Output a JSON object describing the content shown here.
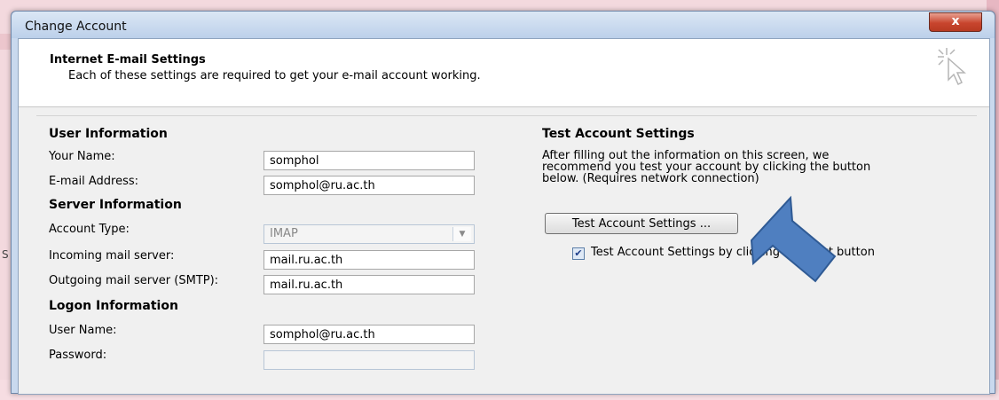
{
  "window": {
    "title": "Change Account",
    "close_label": "x"
  },
  "header": {
    "title": "Internet E-mail Settings",
    "subtitle": "Each of these settings are required to get your e-mail account working."
  },
  "user_info": {
    "section": "User Information",
    "name_label": "Your Name:",
    "name_value": "somphol",
    "email_label": "E-mail Address:",
    "email_value": "somphol@ru.ac.th"
  },
  "server_info": {
    "section": "Server Information",
    "type_label": "Account Type:",
    "type_value": "IMAP",
    "incoming_label": "Incoming mail server:",
    "incoming_value": "mail.ru.ac.th",
    "outgoing_label": "Outgoing mail server (SMTP):",
    "outgoing_value": "mail.ru.ac.th"
  },
  "logon_info": {
    "section": "Logon Information",
    "user_label": "User Name:",
    "user_value": "somphol@ru.ac.th",
    "password_label": "Password:",
    "password_value": ""
  },
  "test": {
    "section": "Test Account Settings",
    "desc_line1": "After filling out the information on this screen, we",
    "desc_line2": "recommend you test your account by clicking the button",
    "desc_line3": "below. (Requires network connection)",
    "button_label": "Test Account Settings ...",
    "checkbox_label": "Test Account Settings by clicking the Next button",
    "checkbox_checked": true
  },
  "background": {
    "edge_letter": "S"
  },
  "colors": {
    "annotation_arrow": "#4f7fc0"
  },
  "icons": {
    "close": "close-icon",
    "logo": "cursor-sparkle-icon",
    "dropdown": "chevron-down-icon",
    "check": "check-icon",
    "annotation": "arrow-pointer-annotation"
  }
}
